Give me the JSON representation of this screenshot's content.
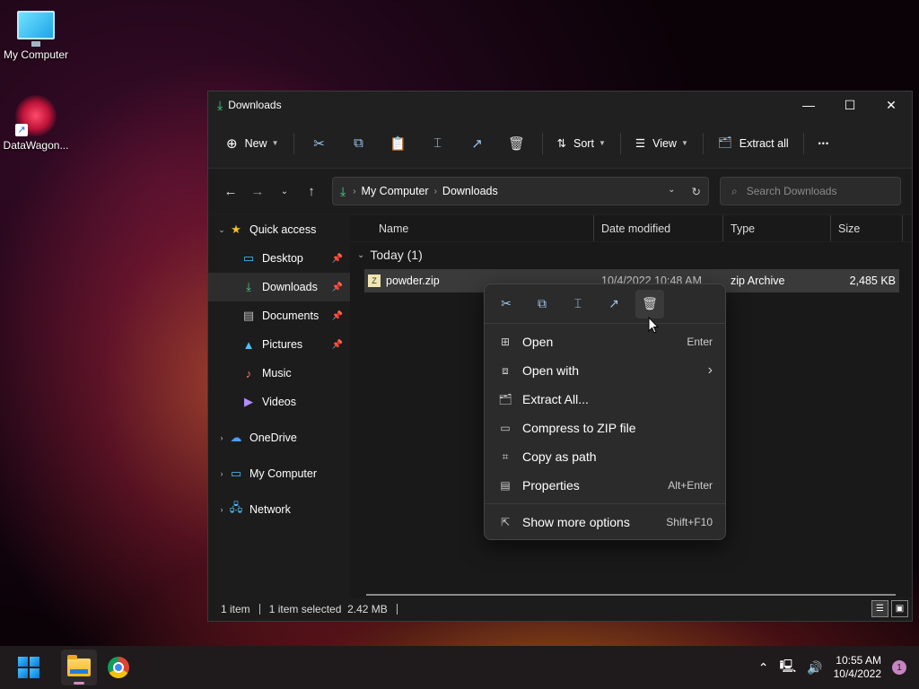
{
  "desktop": {
    "icons": [
      {
        "label": "My Computer"
      },
      {
        "label": "DataWagon..."
      }
    ]
  },
  "window": {
    "title": "Downloads",
    "toolbar": {
      "new_label": "New",
      "sort_label": "Sort",
      "view_label": "View",
      "extract_label": "Extract all",
      "more": "•••"
    },
    "address": {
      "crumbs": [
        "My Computer",
        "Downloads"
      ]
    },
    "search": {
      "placeholder": "Search Downloads"
    },
    "sidebar": {
      "quick_access": "Quick access",
      "items": [
        {
          "label": "Desktop"
        },
        {
          "label": "Downloads"
        },
        {
          "label": "Documents"
        },
        {
          "label": "Pictures"
        },
        {
          "label": "Music"
        },
        {
          "label": "Videos"
        }
      ],
      "onedrive": "OneDrive",
      "my_computer": "My Computer",
      "network": "Network"
    },
    "columns": {
      "name": "Name",
      "date": "Date modified",
      "type": "Type",
      "size": "Size"
    },
    "group": {
      "label": "Today (1)"
    },
    "file": {
      "name": "powder.zip",
      "date": "10/4/2022 10:48 AM",
      "type": "zip Archive",
      "size": "2,485 KB"
    },
    "status": {
      "count": "1 item",
      "selected": "1 item selected  2.42 MB"
    }
  },
  "context_menu": {
    "items": [
      {
        "label": "Open",
        "shortcut": "Enter"
      },
      {
        "label": "Open with",
        "shortcut": "›"
      },
      {
        "label": "Extract All...",
        "shortcut": ""
      },
      {
        "label": "Compress to ZIP file",
        "shortcut": ""
      },
      {
        "label": "Copy as path",
        "shortcut": ""
      },
      {
        "label": "Properties",
        "shortcut": "Alt+Enter"
      }
    ],
    "more": {
      "label": "Show more options",
      "shortcut": "Shift+F10"
    }
  },
  "taskbar": {
    "time": "10:55 AM",
    "date": "10/4/2022",
    "notifications": "1"
  },
  "colors": {
    "accent": "#4cc2ff",
    "selection": "#3a3a3a",
    "window_bg": "#1f1f1f"
  }
}
